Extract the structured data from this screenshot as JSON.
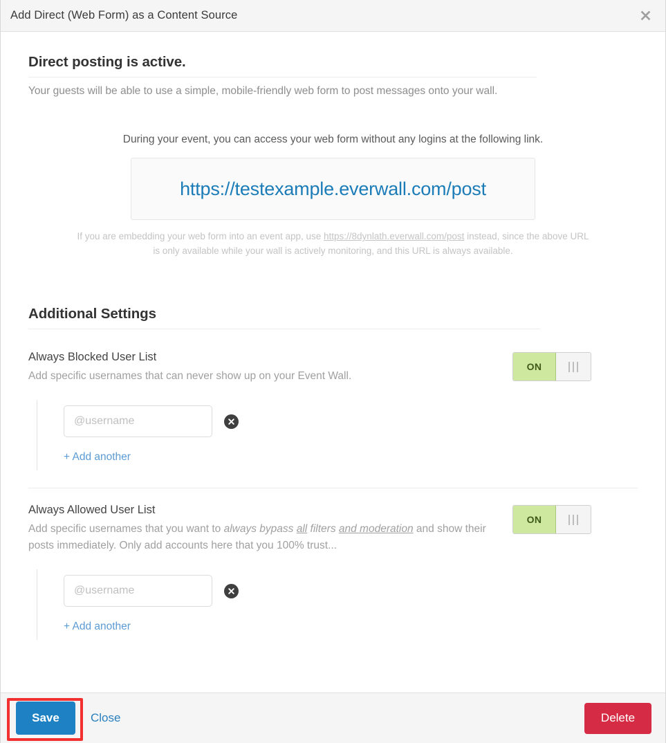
{
  "header": {
    "title": "Add Direct (Web Form) as a Content Source",
    "close_icon": "close-icon"
  },
  "status_section": {
    "heading": "Direct posting is active.",
    "subtitle": "Your guests will be able to use a simple, mobile-friendly web form to post messages onto your wall."
  },
  "link_section": {
    "intro": "During your event, you can access your web form without any logins at the following link.",
    "url": "https://testexample.everwall.com/post",
    "note_before": "If you are embedding your web form into an event app, use ",
    "note_link": "https://8dynlath.everwall.com/post",
    "note_after": " instead, since the above URL is only available while your wall is actively monitoring, and this URL is always available."
  },
  "additional_settings": {
    "heading": "Additional Settings",
    "blocked": {
      "title": "Always Blocked User List",
      "description": "Add specific usernames that can never show up on your Event Wall.",
      "toggle_label": "ON",
      "toggle_state": "on",
      "username_placeholder": "@username",
      "username_value": "",
      "remove_icon": "remove-circle-icon",
      "add_another": "+ Add another"
    },
    "allowed": {
      "title": "Always Allowed User List",
      "description_part1": "Add specific usernames that you want to ",
      "description_italic1": "always bypass ",
      "description_italic_underline1": "all",
      "description_italic2": " filters ",
      "description_italic_underline2": "and moderation",
      "description_part2": " and show their posts immediately. Only add accounts here that you 100% trust...",
      "toggle_label": "ON",
      "toggle_state": "on",
      "username_placeholder": "@username",
      "username_value": "",
      "remove_icon": "remove-circle-icon",
      "add_another": "+ Add another"
    }
  },
  "footer": {
    "save_label": "Save",
    "close_label": "Close",
    "delete_label": "Delete"
  },
  "colors": {
    "save_button": "#1d81c4",
    "delete_button": "#d62b45",
    "link": "#1b7cb8",
    "toggle_on": "#cfe8a0",
    "highlight": "#f23030"
  }
}
